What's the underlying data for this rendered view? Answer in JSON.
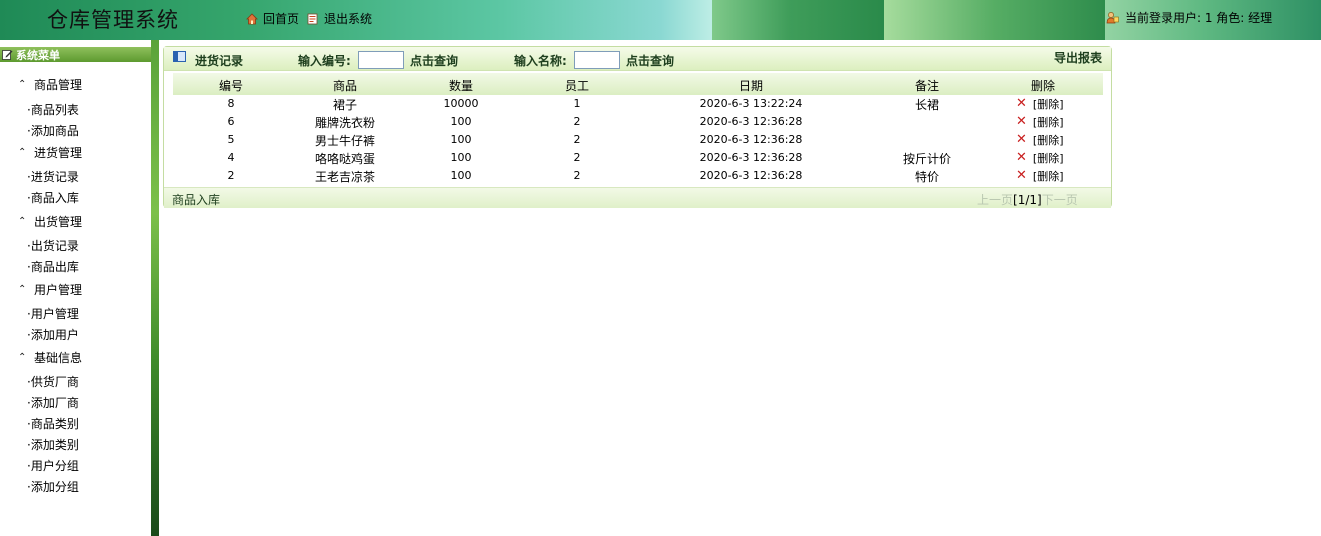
{
  "header": {
    "title": "仓库管理系统",
    "home_label": "回首页",
    "logout_label": "退出系统",
    "user_info": "当前登录用户: 1 角色: 经理"
  },
  "sidebar": {
    "title": "系统菜单",
    "groups": [
      {
        "label": "商品管理",
        "items": [
          "商品列表",
          "添加商品"
        ]
      },
      {
        "label": "进货管理",
        "items": [
          "进货记录",
          "商品入库"
        ]
      },
      {
        "label": "出货管理",
        "items": [
          "出货记录",
          "商品出库"
        ]
      },
      {
        "label": "用户管理",
        "items": [
          "用户管理",
          "添加用户"
        ]
      },
      {
        "label": "基础信息",
        "items": [
          "供货厂商",
          "添加厂商",
          "商品类别",
          "添加类别",
          "用户分组",
          "添加分组"
        ]
      }
    ]
  },
  "panel": {
    "title": "进货记录",
    "search_id_label": "输入编号:",
    "search_id_value": "",
    "search_btn_1": "点击查询",
    "search_name_label": "输入名称:",
    "search_name_value": "",
    "search_btn_2": "点击查询",
    "export_label": "导出报表"
  },
  "table": {
    "headers": [
      "编号",
      "商品",
      "数量",
      "员工",
      "日期",
      "备注",
      "删除"
    ],
    "rows": [
      {
        "id": "8",
        "product": "裙子",
        "qty": "10000",
        "staff": "1",
        "date": "2020-6-3 13:22:24",
        "note": "长裙",
        "delete": "[删除]"
      },
      {
        "id": "6",
        "product": "雕牌洗衣粉",
        "qty": "100",
        "staff": "2",
        "date": "2020-6-3 12:36:28",
        "note": "",
        "delete": "[删除]"
      },
      {
        "id": "5",
        "product": "男士牛仔裤",
        "qty": "100",
        "staff": "2",
        "date": "2020-6-3 12:36:28",
        "note": "",
        "delete": "[删除]"
      },
      {
        "id": "4",
        "product": "咯咯哒鸡蛋",
        "qty": "100",
        "staff": "2",
        "date": "2020-6-3 12:36:28",
        "note": "按斤计价",
        "delete": "[删除]"
      },
      {
        "id": "2",
        "product": "王老吉凉茶",
        "qty": "100",
        "staff": "2",
        "date": "2020-6-3 12:36:28",
        "note": "特价",
        "delete": "[删除]"
      }
    ]
  },
  "footer": {
    "link_label": "商品入库",
    "prev_label": "上一页",
    "page_info": "[1/1]",
    "next_label": "下一页"
  },
  "colors": {
    "accent_green": "#5d9a2f",
    "header_green": "#1f8a56",
    "delete_red": "#c81e1e"
  }
}
